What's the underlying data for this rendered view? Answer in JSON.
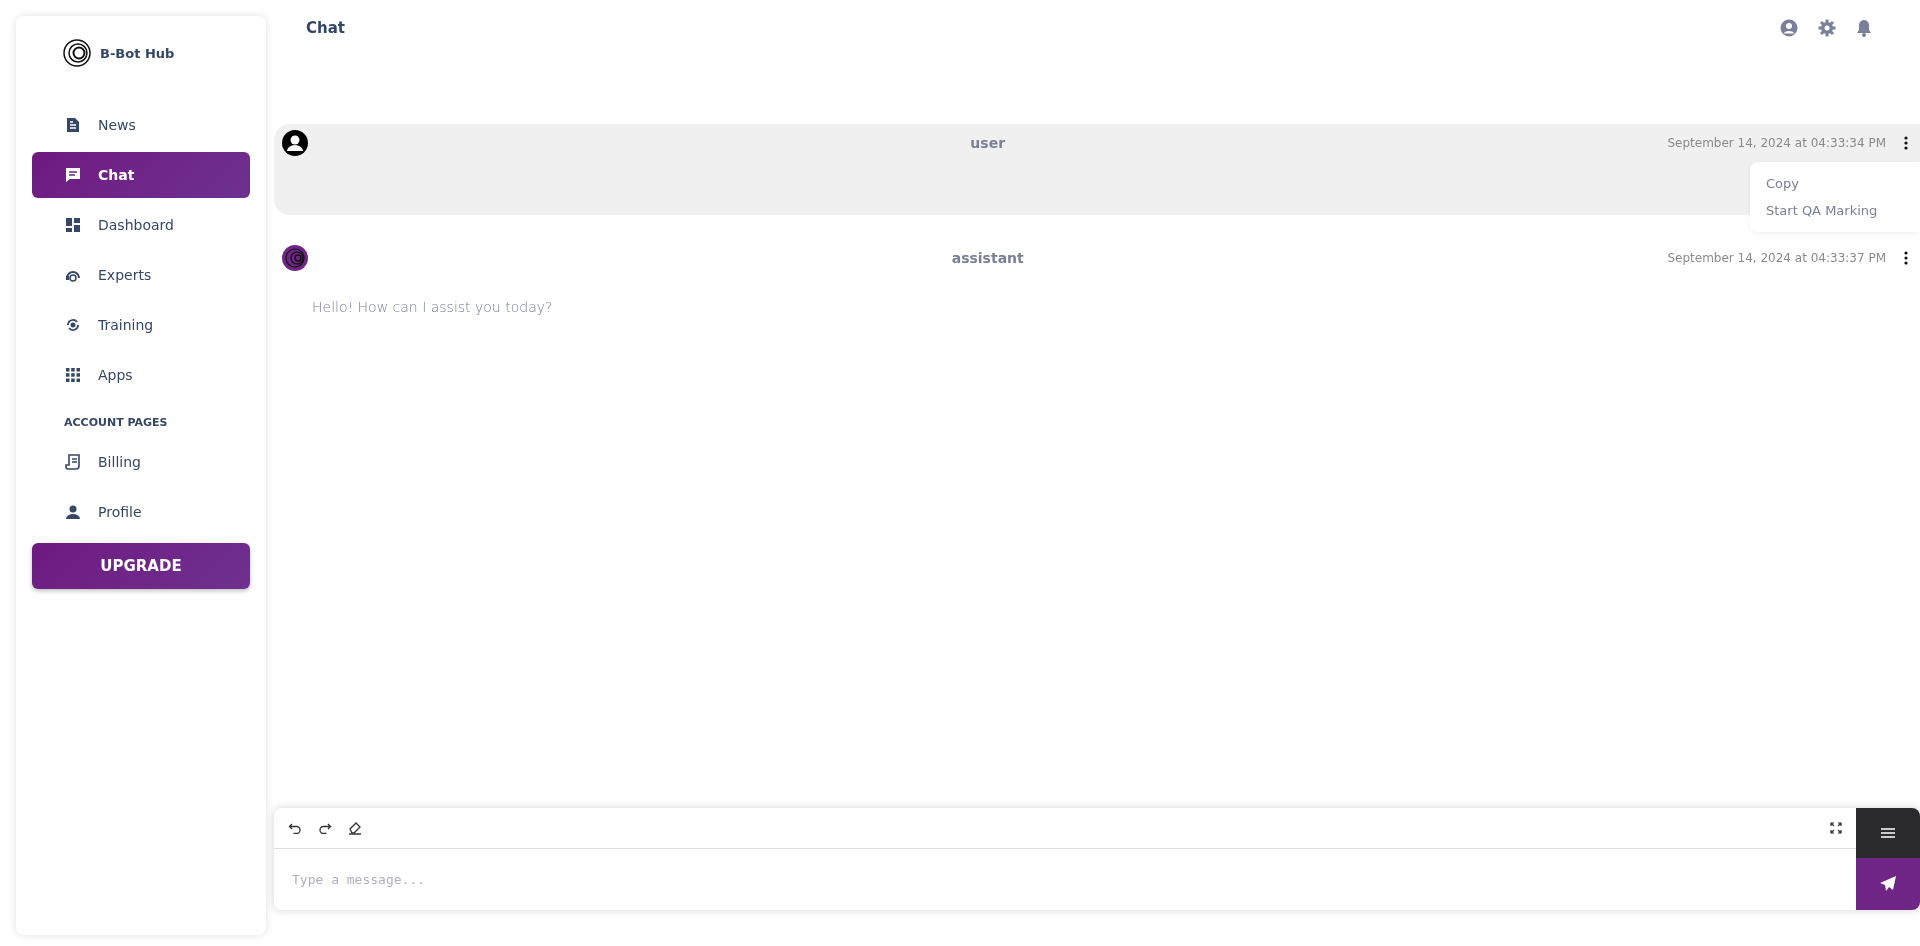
{
  "sidebar": {
    "brand": "B-Bot Hub",
    "items": [
      {
        "label": "News",
        "kind": "news",
        "selected": false
      },
      {
        "label": "Chat",
        "kind": "chat",
        "selected": true
      },
      {
        "label": "Dashboard",
        "kind": "dashboard",
        "selected": false
      },
      {
        "label": "Experts",
        "kind": "experts",
        "selected": false
      },
      {
        "label": "Training",
        "kind": "training",
        "selected": false
      },
      {
        "label": "Apps",
        "kind": "apps",
        "selected": false
      }
    ],
    "section_heading": "ACCOUNT PAGES",
    "account_items": [
      {
        "label": "Billing",
        "kind": "billing",
        "selected": false
      },
      {
        "label": "Profile",
        "kind": "profile",
        "selected": false
      }
    ],
    "upgrade_button": "UPGRADE"
  },
  "header": {
    "title": "Chat"
  },
  "messages": [
    {
      "kind": "user",
      "author": "user",
      "timestamp": "September 14, 2024 at 04:33:34 PM",
      "highlighted": true
    },
    {
      "kind": "assistant",
      "author": "assistant",
      "timestamp": "September 14, 2024 at 04:33:37 PM",
      "highlighted": false,
      "text": "Hello! How can I assist you today?"
    }
  ],
  "context_menu": {
    "items": [
      "Copy",
      "Start QA Marking"
    ]
  },
  "composer": {
    "placeholder": "Type a message..."
  }
}
